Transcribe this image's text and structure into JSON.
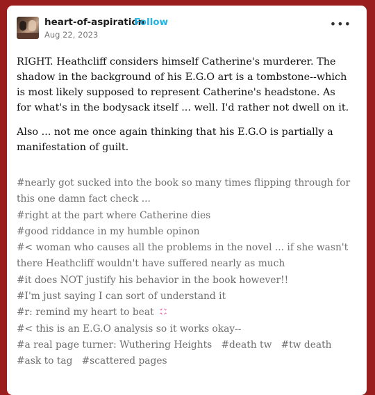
{
  "post": {
    "blog_name": "heart-of-aspiration",
    "follow_label": "Follow",
    "date": "Aug 22, 2023",
    "more_label": "•••",
    "paragraphs": [
      "RIGHT. Heathcliff considers himself Catherine's murderer. The shadow in the background of his E.G.O art is a tombstone--which is most likely supposed to represent Catherine's headstone. As for what's in the bodysack itself ... well. I'd rather not dwell on it.",
      "Also ... not me once again thinking that his E.G.O is partially a manifestation of guilt."
    ],
    "tags": [
      "#nearly got sucked into the book so many times flipping through for this one damn fact check ...",
      "#right at the part where Catherine dies",
      "#good riddance in my humble opinon",
      "#< woman who causes all the problems in the novel ... if she wasn't there Heathcliff wouldn't have suffered nearly as much",
      "#it does NOT justify his behavior in the book however!!",
      "#I'm just saying I can sort of understand it",
      "#r: remind my heart to beat",
      "#< this is an E.G.O analysis so it works okay--",
      "#a real page turner: Wuthering Heights",
      "#death tw",
      "#tw death",
      "#ask to tag",
      "#scattered pages"
    ],
    "emoji_icon": "anger-symbol-icon",
    "colors": {
      "background": "#9b1e1e",
      "card": "#ffffff",
      "follow": "#2ab0e0",
      "tag_text": "#6d6d6d",
      "emoji": "#f06aa8"
    }
  }
}
